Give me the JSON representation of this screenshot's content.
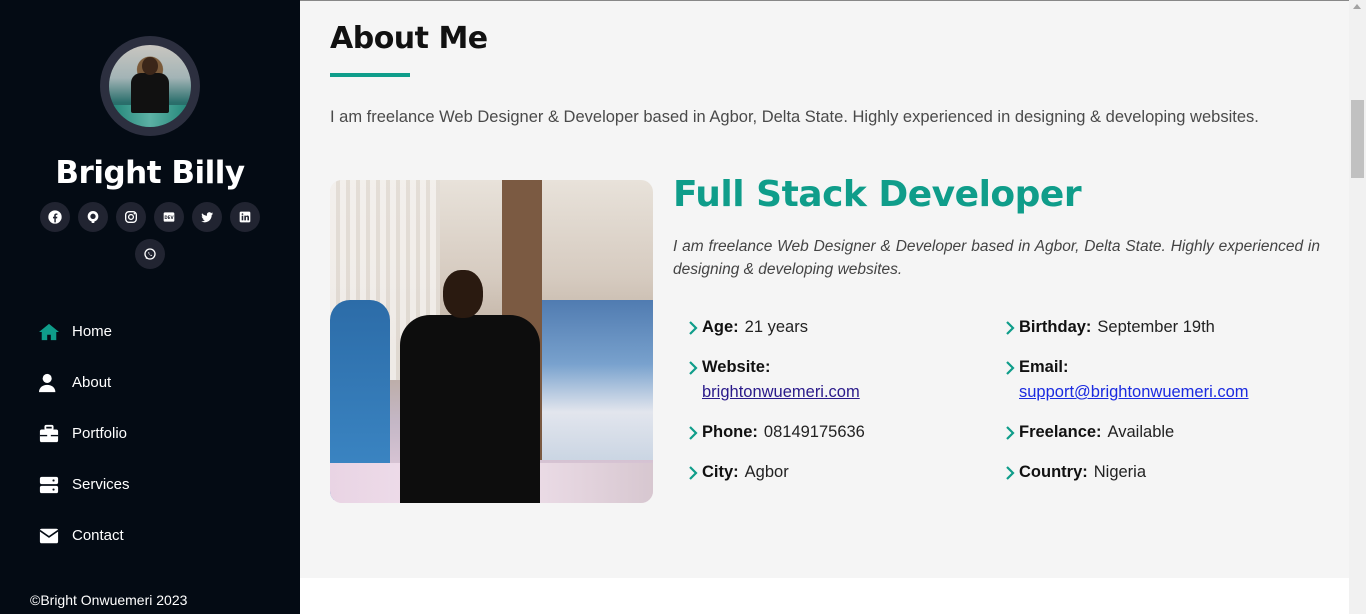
{
  "sidebar": {
    "name": "Bright Billy",
    "socials": [
      {
        "icon": "facebook-icon"
      },
      {
        "icon": "github-icon"
      },
      {
        "icon": "instagram-icon"
      },
      {
        "icon": "dev-icon",
        "text": "DEV"
      },
      {
        "icon": "twitter-icon"
      },
      {
        "icon": "linkedin-icon"
      },
      {
        "icon": "whatsapp-icon"
      }
    ],
    "nav": [
      {
        "label": "Home",
        "icon": "home-icon",
        "active": true
      },
      {
        "label": "About",
        "icon": "user-icon"
      },
      {
        "label": "Portfolio",
        "icon": "briefcase-icon"
      },
      {
        "label": "Services",
        "icon": "server-icon"
      },
      {
        "label": "Contact",
        "icon": "envelope-icon"
      }
    ],
    "footer": "©Bright Onwuemeri 2023"
  },
  "about": {
    "title": "About Me",
    "intro": "I am freelance Web Designer & Developer based in Agbor, Delta State. Highly experienced in designing & developing websites.",
    "role": "Full Stack Developer",
    "role_desc": "I am freelance Web Designer & Developer based in Agbor, Delta State. Highly experienced in designing & developing websites.",
    "facts": {
      "age": {
        "key": "Age:",
        "value": "21 years"
      },
      "birthday": {
        "key": "Birthday:",
        "value": "September 19th"
      },
      "website": {
        "key": "Website:",
        "value": "brightonwuemeri.com"
      },
      "email": {
        "key": "Email:",
        "value": "support@brightonwuemeri.com"
      },
      "phone": {
        "key": "Phone:",
        "value": "08149175636"
      },
      "freelance": {
        "key": "Freelance:",
        "value": "Available"
      },
      "city": {
        "key": "City:",
        "value": "Agbor"
      },
      "country": {
        "key": "Country:",
        "value": "Nigeria"
      }
    }
  },
  "colors": {
    "sidebar_bg": "#040b14",
    "accent": "#0f9d8a",
    "main_bg": "#f5f5f5"
  }
}
